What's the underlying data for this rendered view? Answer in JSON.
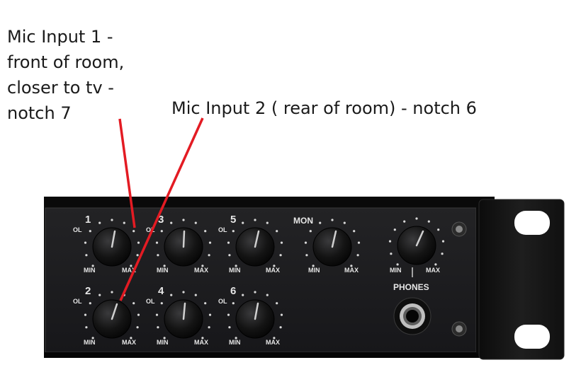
{
  "annotations": {
    "mic1": [
      "Mic Input 1 -",
      "front of room,",
      "closer to tv -",
      "notch 7"
    ],
    "mic2": "Mic Input 2 ( rear of room) - notch 6"
  },
  "panel": {
    "channels": [
      {
        "number": "1",
        "ol": "OL",
        "min": "MIN",
        "max": "MAX"
      },
      {
        "number": "2",
        "ol": "OL",
        "min": "MIN",
        "max": "MAX"
      },
      {
        "number": "3",
        "ol": "OL",
        "min": "MIN",
        "max": "MAX"
      },
      {
        "number": "4",
        "ol": "OL",
        "min": "MIN",
        "max": "MAX"
      },
      {
        "number": "5",
        "ol": "OL",
        "min": "MIN",
        "max": "MAX"
      },
      {
        "number": "6",
        "ol": "OL",
        "min": "MIN",
        "max": "MAX"
      }
    ],
    "mon": {
      "label": "MON",
      "min": "MIN",
      "max": "MAX"
    },
    "phones": {
      "label": "PHONES",
      "min": "MIN",
      "max": "MAX"
    }
  },
  "colors": {
    "annotation_line": "#e31b23",
    "panel": "#1c1c1e"
  }
}
